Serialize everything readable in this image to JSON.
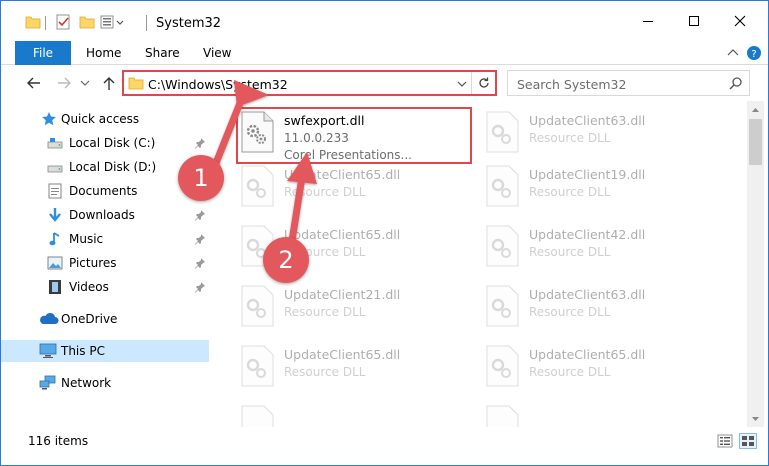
{
  "window": {
    "title": "System32",
    "accent_color": "#1979ca",
    "highlight_color": "#e0474c"
  },
  "ribbon": {
    "tabs": [
      "File",
      "Home",
      "Share",
      "View"
    ]
  },
  "address": {
    "path": "C:\\Windows\\System32",
    "search_placeholder": "Search System32"
  },
  "navpane": {
    "items": [
      {
        "label": "Quick access",
        "icon": "star-icon",
        "pinned": false
      },
      {
        "label": "Local Disk (C:)",
        "icon": "drive-icon",
        "pinned": true
      },
      {
        "label": "Local Disk (D:)",
        "icon": "drive-icon",
        "pinned": false
      },
      {
        "label": "Documents",
        "icon": "documents-icon",
        "pinned": false
      },
      {
        "label": "Downloads",
        "icon": "download-arrow-icon",
        "pinned": true
      },
      {
        "label": "Music",
        "icon": "music-note-icon",
        "pinned": true
      },
      {
        "label": "Pictures",
        "icon": "pictures-icon",
        "pinned": true
      },
      {
        "label": "Videos",
        "icon": "film-icon",
        "pinned": true
      },
      {
        "label": "OneDrive",
        "icon": "cloud-icon",
        "pinned": false
      },
      {
        "label": "This PC",
        "icon": "monitor-icon",
        "pinned": false,
        "selected": true
      },
      {
        "label": "Network",
        "icon": "network-icon",
        "pinned": false
      }
    ]
  },
  "files": {
    "highlighted": {
      "name": "swfexport.dll",
      "version": "11.0.0.233",
      "description": "Corel Presentations..."
    },
    "left_column": [
      {
        "name": "UpdateClient65.dll",
        "type": "Resource DLL"
      },
      {
        "name": "UpdateClient65.dll",
        "type": "Resource DLL"
      },
      {
        "name": "UpdateClient21.dll",
        "type": "Resource DLL"
      },
      {
        "name": "UpdateClient65.dll",
        "type": "Resource DLL"
      }
    ],
    "right_column": [
      {
        "name": "UpdateClient63.dll",
        "type": "Resource DLL"
      },
      {
        "name": "UpdateClient19.dll",
        "type": "Resource DLL"
      },
      {
        "name": "UpdateClient42.dll",
        "type": "Resource DLL"
      },
      {
        "name": "UpdateClient63.dll",
        "type": "Resource DLL"
      },
      {
        "name": "UpdateClient65.dll",
        "type": "Resource DLL"
      }
    ]
  },
  "status": {
    "item_count": "116 items"
  },
  "annotations": {
    "badge_1": "1",
    "badge_2": "2"
  }
}
